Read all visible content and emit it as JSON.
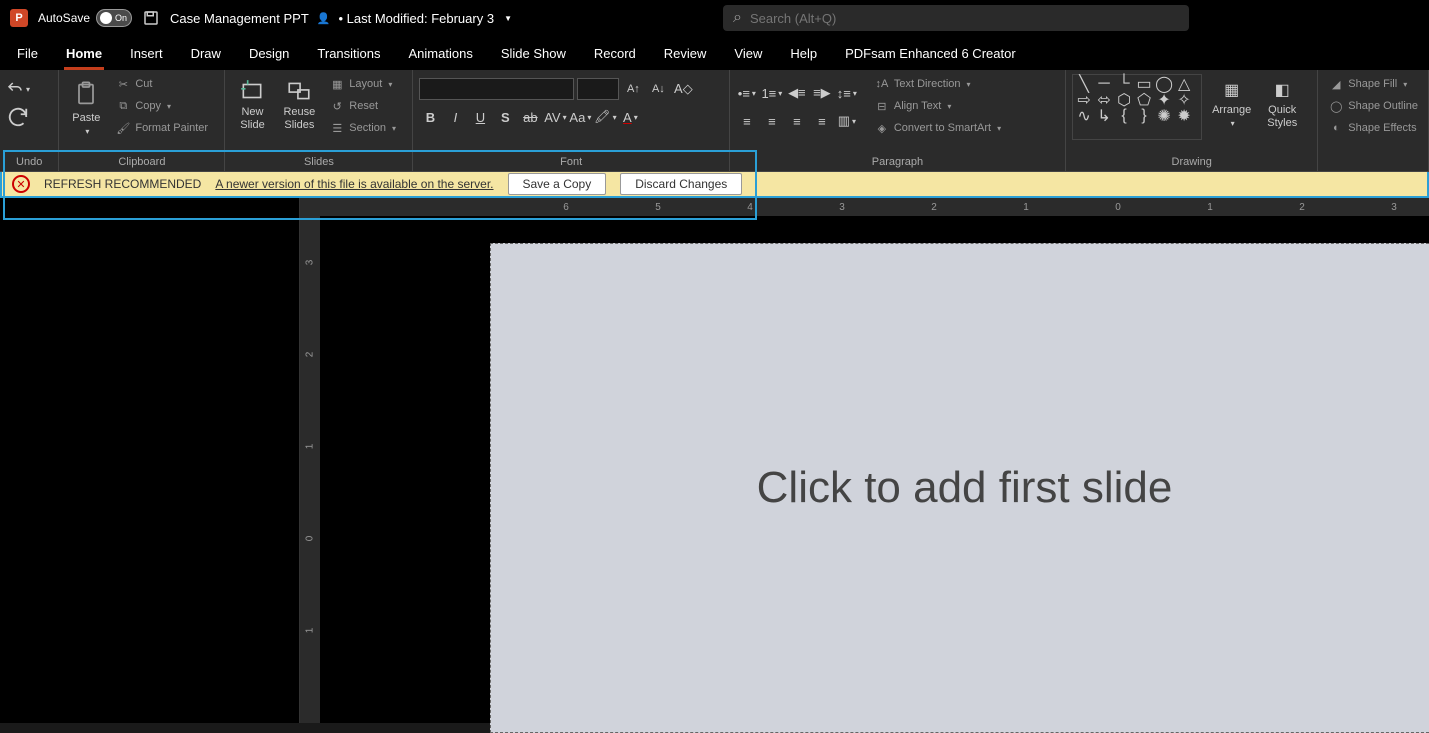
{
  "titlebar": {
    "autosave": "AutoSave",
    "autosave_state": "On",
    "doc": "Case Management PPT",
    "modified": "• Last Modified: February 3",
    "search_placeholder": "Search (Alt+Q)"
  },
  "tabs": {
    "file": "File",
    "home": "Home",
    "insert": "Insert",
    "draw": "Draw",
    "design": "Design",
    "transitions": "Transitions",
    "animations": "Animations",
    "slideshow": "Slide Show",
    "record": "Record",
    "review": "Review",
    "view": "View",
    "help": "Help",
    "pdfsam": "PDFsam Enhanced 6 Creator"
  },
  "ribbon": {
    "undo": "Undo",
    "clipboard": {
      "label": "Clipboard",
      "paste": "Paste",
      "cut": "Cut",
      "copy": "Copy",
      "fmt": "Format Painter"
    },
    "slides": {
      "label": "Slides",
      "new": "New\nSlide",
      "reuse": "Reuse\nSlides",
      "layout": "Layout",
      "reset": "Reset",
      "section": "Section"
    },
    "font": {
      "label": "Font"
    },
    "paragraph": {
      "label": "Paragraph",
      "dir": "Text Direction",
      "align": "Align Text",
      "smart": "Convert to SmartArt"
    },
    "drawing": {
      "label": "Drawing",
      "arrange": "Arrange",
      "quick": "Quick\nStyles",
      "fill": "Shape Fill",
      "outline": "Shape Outline",
      "effects": "Shape Effects"
    }
  },
  "notification": {
    "title": "REFRESH RECOMMENDED",
    "msg": "A newer version of this file is available on the server.",
    "save": "Save a Copy",
    "discard": "Discard Changes"
  },
  "canvas": {
    "prompt": "Click to add first slide"
  },
  "ruler_h": [
    "6",
    "5",
    "4",
    "3",
    "2",
    "1",
    "0",
    "1",
    "2",
    "3"
  ],
  "ruler_v": [
    "3",
    "2",
    "1",
    "0",
    "1"
  ]
}
